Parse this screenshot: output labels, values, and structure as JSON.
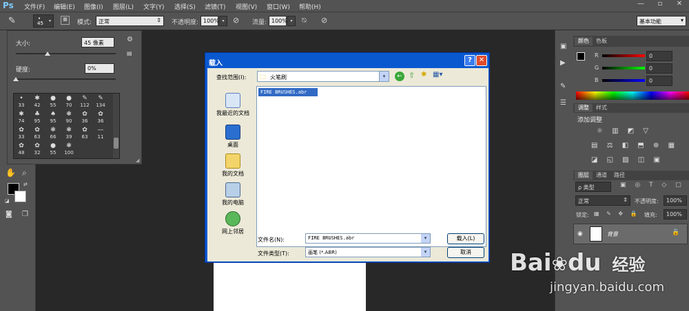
{
  "menu": {
    "logo": "Ps",
    "items": [
      "文件(F)",
      "编辑(E)",
      "图像(I)",
      "图层(L)",
      "文字(Y)",
      "选择(S)",
      "滤镜(T)",
      "视图(V)",
      "窗口(W)",
      "帮助(H)"
    ]
  },
  "window_controls": {
    "minimize": "—",
    "restore": "▫",
    "close": "✕"
  },
  "options": {
    "brush_size": "45",
    "mode_label": "模式:",
    "mode_value": "正常",
    "opacity_label": "不透明度:",
    "opacity_value": "100%",
    "flow_label": "流量:",
    "flow_value": "100%",
    "workspace": "基本功能"
  },
  "brush_panel": {
    "size_label": "大小:",
    "size_value": "45 像素",
    "hardness_label": "硬度:",
    "hardness_value": "0%",
    "slider_size_fraction": 0.32,
    "slider_hardness_fraction": 0.0,
    "presets": [
      "33",
      "42",
      "55",
      "70",
      "112",
      "134",
      "74",
      "95",
      "95",
      "90",
      "36",
      "36",
      "33",
      "63",
      "66",
      "39",
      "63",
      "11",
      "48",
      "32",
      "55",
      "100"
    ]
  },
  "dialog": {
    "title": "载入",
    "look_in_label": "查找范围(I):",
    "folder": "火笔刷",
    "places": [
      "我最近的文档",
      "桌面",
      "我的文档",
      "我的电脑",
      "网上邻居"
    ],
    "file_item": "FIRE BRUSHES.abr",
    "filename_label": "文件名(N):",
    "filename_value": "FIRE BRUSHES.abr",
    "filetype_label": "文件类型(T):",
    "filetype_value": "画笔 (*.ABR)",
    "load_button": "载入(L)",
    "cancel_button": "取消",
    "help_button": "?",
    "close_button": "✕"
  },
  "color_panel": {
    "tabs": [
      "颜色",
      "色板"
    ],
    "channels": [
      {
        "name": "R",
        "value": "0"
      },
      {
        "name": "G",
        "value": "0"
      },
      {
        "name": "B",
        "value": "0"
      }
    ]
  },
  "adjust_panel": {
    "tabs": [
      "调整",
      "样式"
    ],
    "heading": "添加调整"
  },
  "layers_panel": {
    "tabs": [
      "图层",
      "通道",
      "路径"
    ],
    "kind_label": "ρ 类型",
    "blend_mode": "正常",
    "opacity_label": "不透明度:",
    "opacity_value": "100%",
    "lock_label": "锁定:",
    "fill_label": "填充:",
    "fill_value": "100%",
    "layer_name": "背景"
  },
  "watermark": {
    "brand": "Bai",
    "brand2": "du",
    "product": "经验",
    "url": "jingyan.baidu.com"
  },
  "colors": {
    "ps_bg": "#535353",
    "canvas_bg": "#282828",
    "xp_title": "#0a58d0",
    "xp_face": "#ece9d8",
    "selection": "#316ac5"
  }
}
